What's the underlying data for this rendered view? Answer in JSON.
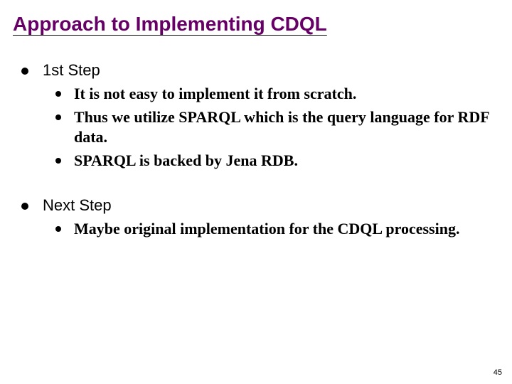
{
  "title": "Approach to Implementing CDQL",
  "sections": [
    {
      "label": "1st Step",
      "items": [
        "It is not easy to implement it from scratch.",
        "Thus we utilize SPARQL which is the query language for RDF data.",
        "SPARQL is backed by Jena RDB."
      ]
    },
    {
      "label": "Next Step",
      "items": [
        "Maybe original implementation for the CDQL processing."
      ]
    }
  ],
  "page_number": "45"
}
